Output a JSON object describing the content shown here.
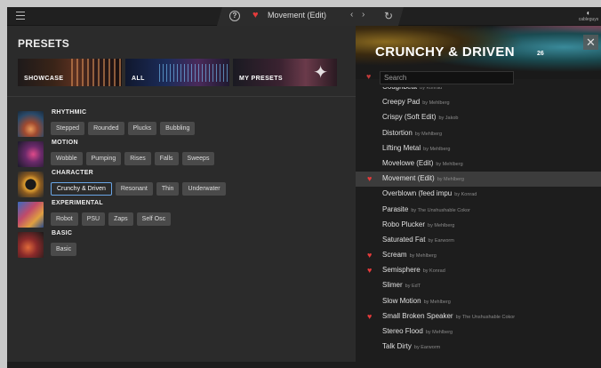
{
  "topbar": {
    "preset_name": "Movement (Edit)",
    "logo_text": "cableguys",
    "icons": [
      "menu-icon",
      "help-icon",
      "heart-icon",
      "chevron-left-icon",
      "chevron-right-icon",
      "refresh-icon"
    ]
  },
  "left": {
    "title": "PRESETS",
    "banners": [
      "SHOWCASE",
      "ALL",
      "MY PRESETS"
    ],
    "categories": [
      {
        "name": "RHYTHMIC",
        "chips": [
          "Stepped",
          "Rounded",
          "Plucks",
          "Bubbling"
        ]
      },
      {
        "name": "MOTION",
        "chips": [
          "Wobble",
          "Pumping",
          "Rises",
          "Falls",
          "Sweeps"
        ]
      },
      {
        "name": "CHARACTER",
        "chips": [
          "Crunchy & Driven",
          "Resonant",
          "Thin",
          "Underwater"
        ],
        "selected": "Crunchy & Driven"
      },
      {
        "name": "EXPERIMENTAL",
        "chips": [
          "Robot",
          "PSU",
          "Zaps",
          "Self Osc"
        ]
      },
      {
        "name": "BASIC",
        "chips": [
          "Basic"
        ]
      }
    ]
  },
  "right": {
    "title": "CRUNCHY & DRIVEN",
    "count": "26",
    "search_placeholder": "Search",
    "presets": [
      {
        "name": "Coughbeat",
        "author": "by Konrad",
        "fav": false
      },
      {
        "name": "Creepy Pad",
        "author": "by Mehlberg",
        "fav": false
      },
      {
        "name": "Crispy (Soft Edit)",
        "author": "by Jakob",
        "fav": false
      },
      {
        "name": "Distortion",
        "author": "by Mehlberg",
        "fav": false
      },
      {
        "name": "Lifting Metal",
        "author": "by Mehlberg",
        "fav": false
      },
      {
        "name": "Movelowe (Edit)",
        "author": "by Mehlberg",
        "fav": false
      },
      {
        "name": "Movement (Edit)",
        "author": "by Mehlberg",
        "fav": true,
        "active": true
      },
      {
        "name": "Overblown (feed impu",
        "author": "by Konrad",
        "fav": false
      },
      {
        "name": "Parasite",
        "author": "by The Unshushable Cokor",
        "fav": false
      },
      {
        "name": "Robo Plucker",
        "author": "by Mehlberg",
        "fav": false
      },
      {
        "name": "Saturated Fat",
        "author": "by Earworm",
        "fav": false
      },
      {
        "name": "Scream",
        "author": "by Mehlberg",
        "fav": true
      },
      {
        "name": "Semisphere",
        "author": "by Konrad",
        "fav": true
      },
      {
        "name": "Slimer",
        "author": "by EdT",
        "fav": false
      },
      {
        "name": "Slow Motion",
        "author": "by Mehlberg",
        "fav": false
      },
      {
        "name": "Small Broken Speaker",
        "author": "by The Unshushable Cokor",
        "fav": true
      },
      {
        "name": "Stereo Flood",
        "author": "by Mehlberg",
        "fav": false
      },
      {
        "name": "Talk Dirty",
        "author": "by Earworm",
        "fav": false
      }
    ]
  },
  "colors": {
    "accent_blue": "#6aa6e6",
    "heart_red": "#e53b3b",
    "panel_dark": "#1d1d1d",
    "panel": "#2b2b2b",
    "chip": "#4a4a4a"
  }
}
